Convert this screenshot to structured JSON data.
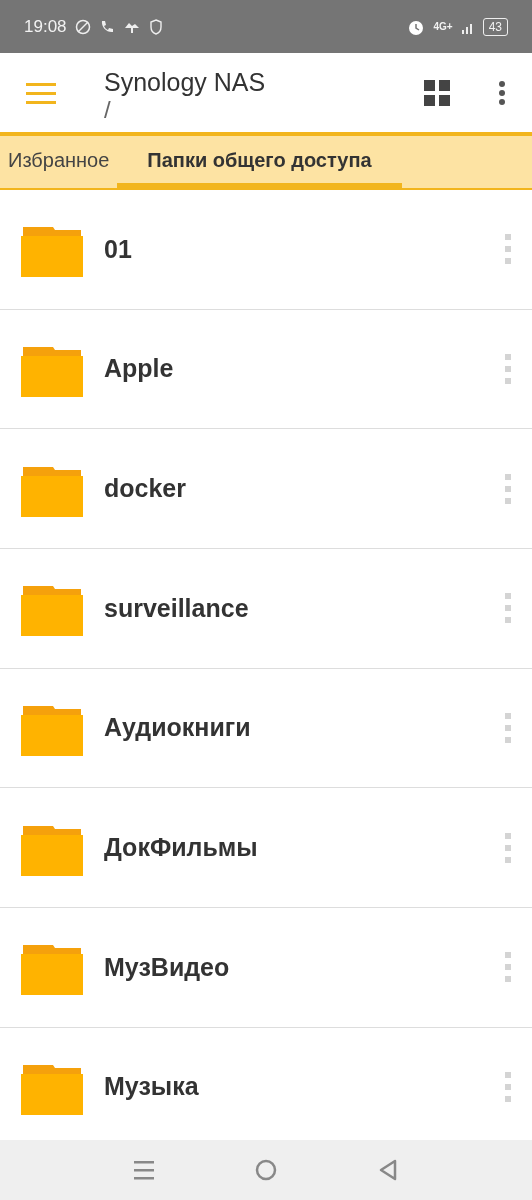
{
  "status_bar": {
    "time": "19:08",
    "network": "4G+",
    "battery": "43"
  },
  "app_bar": {
    "title": "Synology NAS",
    "path": "/"
  },
  "tabs": [
    {
      "label": "Избранное",
      "selected": false
    },
    {
      "label": "Папки общего доступа",
      "selected": true
    }
  ],
  "folders": [
    {
      "name": "01"
    },
    {
      "name": "Apple"
    },
    {
      "name": "docker"
    },
    {
      "name": "surveillance"
    },
    {
      "name": "Аудиокниги"
    },
    {
      "name": "ДокФильмы"
    },
    {
      "name": "МузВидео"
    },
    {
      "name": "Музыка"
    }
  ]
}
